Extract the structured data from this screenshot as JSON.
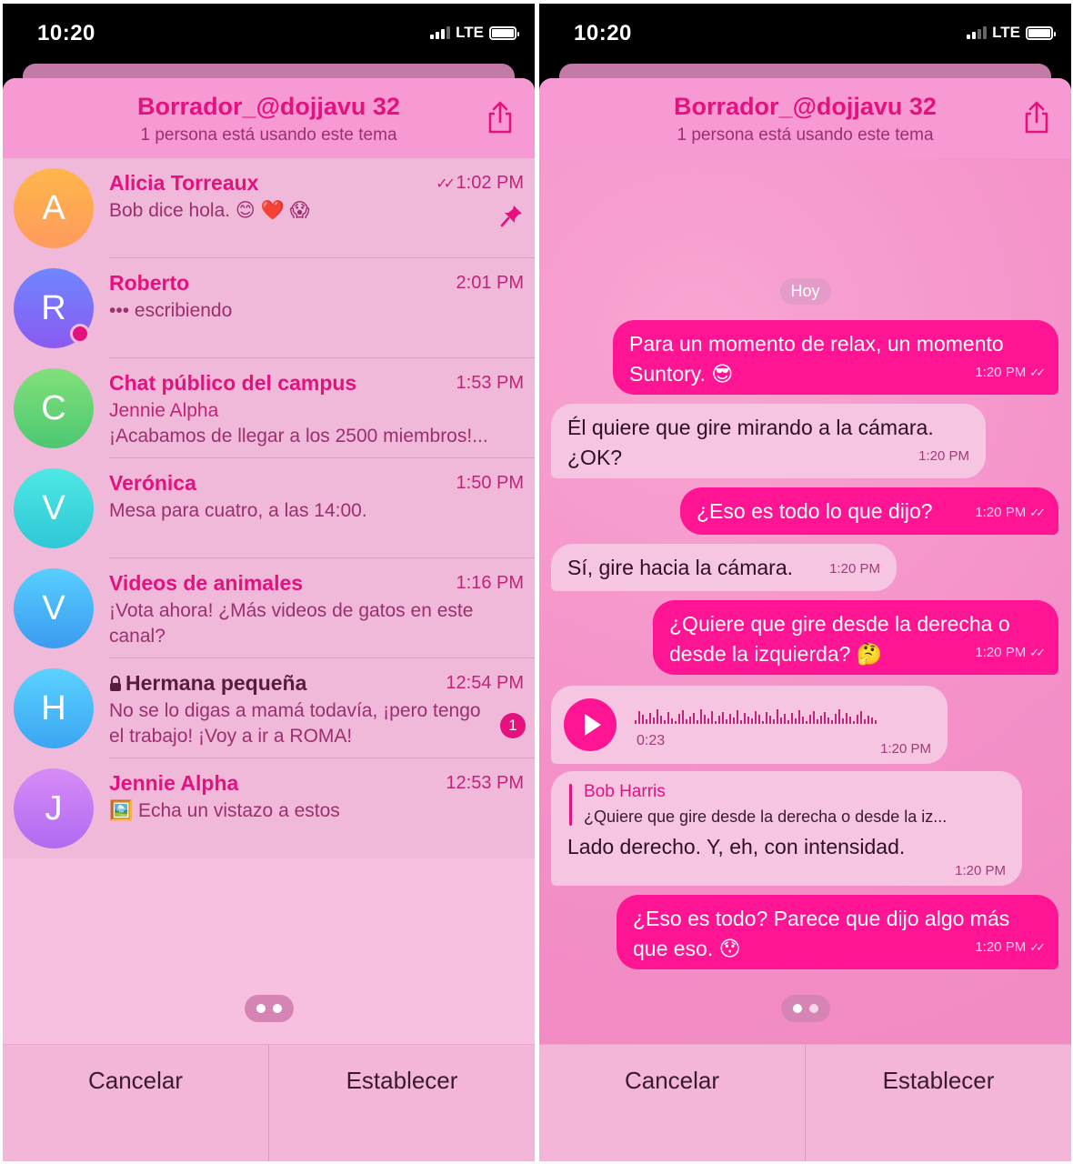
{
  "status": {
    "time": "10:20",
    "network": "LTE"
  },
  "header": {
    "title": "Borrador_@dojjavu 32",
    "subtitle": "1 persona está usando este tema"
  },
  "chats": [
    {
      "initial": "A",
      "name": "Alicia Torreaux",
      "time": "1:02 PM",
      "message": "Bob dice hola. 😊 ❤️ 😱",
      "read": true,
      "pinned": true
    },
    {
      "initial": "R",
      "name": "Roberto",
      "time": "2:01 PM",
      "message": "••• escribiendo",
      "online": true
    },
    {
      "initial": "C",
      "name": "Chat público del campus",
      "time": "1:53 PM",
      "sender": "Jennie Alpha",
      "message": "¡Acabamos de llegar a los 2500 miembros!..."
    },
    {
      "initial": "V",
      "name": "Verónica",
      "time": "1:50 PM",
      "message": "Mesa para cuatro, a las 14:00."
    },
    {
      "initial": "V",
      "name": "Videos de animales",
      "time": "1:16 PM",
      "message": "¡Vota ahora! ¿Más videos de gatos en este canal?"
    },
    {
      "initial": "H",
      "name": "Hermana pequeña",
      "time": "12:54 PM",
      "message": "No se lo digas a mamá todavía, ¡pero tengo el trabajo! ¡Voy a ir a ROMA!",
      "badge": "1",
      "secret": true
    },
    {
      "initial": "J",
      "name": "Jennie Alpha",
      "time": "12:53 PM",
      "message": "🖼️ Echa un vistazo a estos"
    }
  ],
  "chat": {
    "date_label": "Hoy",
    "messages": [
      {
        "dir": "out",
        "text": "Para un momento de relax, un momento Suntory. 😎",
        "time": "1:20 PM"
      },
      {
        "dir": "in",
        "text": "Él quiere que gire mirando a la cámara. ¿OK?",
        "time": "1:20 PM"
      },
      {
        "dir": "out",
        "text": "¿Eso es todo lo que dijo?",
        "time": "1:20 PM"
      },
      {
        "dir": "in",
        "text": "Sí, gire hacia la cámara.",
        "time": "1:20 PM"
      },
      {
        "dir": "out",
        "text": "¿Quiere que gire desde la derecha o desde la izquierda? 🤔",
        "time": "1:20 PM"
      },
      {
        "dir": "out",
        "text": "¿Eso es todo? Parece que dijo algo más que eso. 😯",
        "time": "1:20 PM"
      }
    ],
    "voice": {
      "duration": "0:23",
      "time": "1:20 PM"
    },
    "reply": {
      "author": "Bob Harris",
      "quote": "¿Quiere que gire desde la derecha o desde la iz...",
      "text": "Lado derecho. Y, eh, con intensidad.",
      "time": "1:20 PM"
    }
  },
  "buttons": {
    "cancel": "Cancelar",
    "set": "Establecer"
  },
  "colors": {
    "accent": "#e5117f",
    "bubble_out": "#ff1493",
    "bubble_in": "#f5c5e2",
    "header": "#f79ad3"
  }
}
